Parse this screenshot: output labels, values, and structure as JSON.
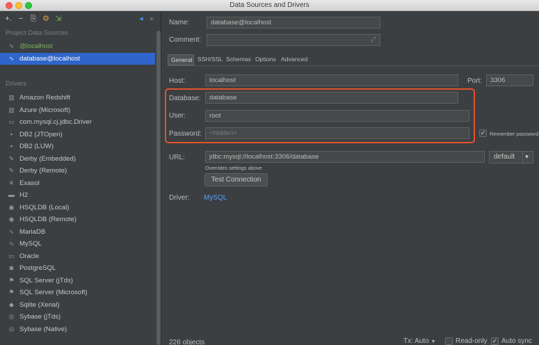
{
  "window": {
    "title": "Data Sources and Drivers"
  },
  "left": {
    "toolbar": [
      {
        "name": "add-icon",
        "glyph": "+."
      },
      {
        "name": "remove-icon",
        "glyph": "−"
      },
      {
        "name": "copy-icon",
        "glyph": "⎘"
      },
      {
        "name": "driver-settings-icon",
        "glyph": "⚙"
      },
      {
        "name": "import-icon",
        "glyph": "⇲"
      },
      {
        "name": "back-icon",
        "glyph": "◂"
      },
      {
        "name": "forward-icon",
        "glyph": "▸"
      }
    ],
    "project_header": "Project Data Sources",
    "sources": [
      {
        "label": "@localhost",
        "style": "green"
      },
      {
        "label": "database@localhost",
        "style": "selected"
      }
    ],
    "drivers_header": "Drivers",
    "drivers": [
      {
        "label": "Amazon Redshift",
        "icon": "▥"
      },
      {
        "label": "Azure (Microsoft)",
        "icon": "▥"
      },
      {
        "label": "com.mysql.cj.jdbc.Driver",
        "icon": "▭"
      },
      {
        "label": "DB2 (JTOpen)",
        "icon": "▪"
      },
      {
        "label": "DB2 (LUW)",
        "icon": "▪"
      },
      {
        "label": "Derby (Embedded)",
        "icon": "✎"
      },
      {
        "label": "Derby (Remote)",
        "icon": "✎"
      },
      {
        "label": "Exasol",
        "icon": "✕"
      },
      {
        "label": "H2",
        "icon": "▬"
      },
      {
        "label": "HSQLDB (Local)",
        "icon": "◉"
      },
      {
        "label": "HSQLDB (Remote)",
        "icon": "◉"
      },
      {
        "label": "MariaDB",
        "icon": "∿"
      },
      {
        "label": "MySQL",
        "icon": "∿"
      },
      {
        "label": "Oracle",
        "icon": "▭"
      },
      {
        "label": "PostgreSQL",
        "icon": "◙"
      },
      {
        "label": "SQL Server (jTds)",
        "icon": "⚑"
      },
      {
        "label": "SQL Server (Microsoft)",
        "icon": "⚑"
      },
      {
        "label": "Sqlite (Xerial)",
        "icon": "◆"
      },
      {
        "label": "Sybase (jTds)",
        "icon": "◎"
      },
      {
        "label": "Sybase (Native)",
        "icon": "◎"
      }
    ]
  },
  "form": {
    "name_label": "Name:",
    "name_value": "database@localhost",
    "comment_label": "Comment:",
    "comment_value": "",
    "tabs": [
      "General",
      "SSH/SSL",
      "Schemas",
      "Options",
      "Advanced"
    ],
    "host_label": "Host:",
    "host_value": "localhost",
    "port_label": "Port:",
    "port_value": "3306",
    "database_label": "Database:",
    "database_value": "database",
    "user_label": "User:",
    "user_value": "root",
    "password_label": "Password:",
    "password_placeholder": "<hidden>",
    "remember_password": "Remember password",
    "url_label": "URL:",
    "url_value": "jdbc:mysql://localhost:3306/database",
    "url_mode": "default",
    "overrides_note": "Overrides settings above",
    "test_connection": "Test Connection",
    "driver_label": "Driver:",
    "driver_value": "MySQL"
  },
  "footer": {
    "objects_count": "226 objects",
    "tx_mode": "Tx: Auto",
    "read_only": "Read-only",
    "auto_sync": "Auto sync"
  },
  "colors": {
    "accent": "#2f65ca",
    "link": "#589df6",
    "highlight": "#e2532c",
    "background": "#3c3f41"
  }
}
